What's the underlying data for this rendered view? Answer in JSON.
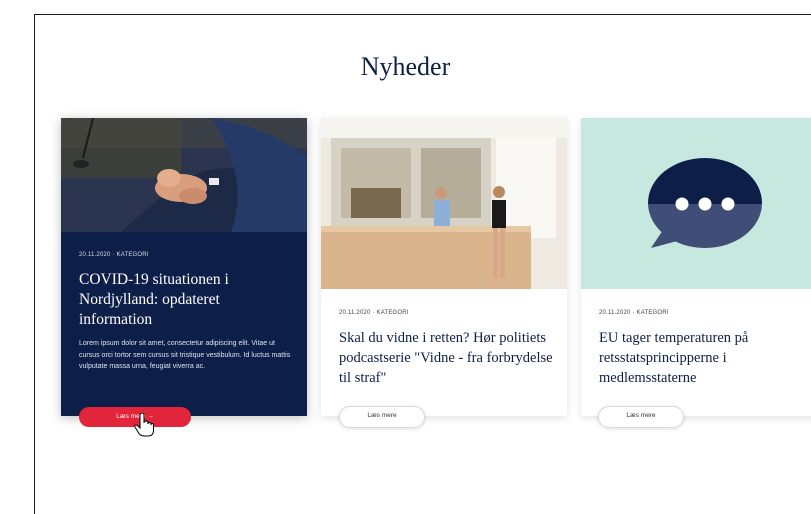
{
  "section": {
    "title": "Nyheder"
  },
  "cards": [
    {
      "meta": "20.11.2020  ·  KATEGORI",
      "title": "COVID-19 situationen i Nordjylland: opdateret information",
      "excerpt": "Lorem ipsum dolor sit amet, consectetur adipiscing elit. Vitae ut cursus orci tortor sem cursus sit tristique vestibulum. Id luctus mattis vulputate massa urna, feugiat viverra ac.",
      "button": "Læs mere →",
      "image": "hands-photo"
    },
    {
      "meta": "20.11.2020  ·  KATEGORI",
      "title": "Skal du vidne i retten? Hør politiets podcastserie \"Vidne - fra forbrydelse til straf\"",
      "button": "Læs mere",
      "image": "reception-photo"
    },
    {
      "meta": "20.11.2020  ·  KATEGORI",
      "title": "EU tager temperaturen på retsstatsprincipperne i medlemsstaterne",
      "button": "Læs mere",
      "image": "chat-bubble-icon"
    }
  ],
  "colors": {
    "navy": "#0d1f48",
    "red": "#e2253a",
    "mint": "#c7e8df"
  }
}
